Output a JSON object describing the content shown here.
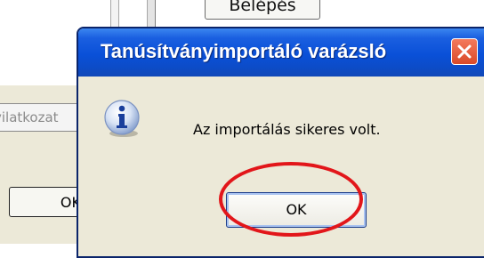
{
  "background": {
    "login_button_label": "Belépés",
    "input_text": "vilatkozat",
    "ok_button_label": "OK"
  },
  "dialog": {
    "title": "Tanúsítványimportáló varázsló",
    "message": "Az importálás sikeres volt.",
    "ok_label": "OK",
    "icon": "info-icon",
    "close_icon": "close-icon"
  },
  "colors": {
    "titlebar": "#0a50d8",
    "close_button": "#d94a2a",
    "highlight": "#e2161a",
    "dialog_body": "#ece9d8"
  }
}
